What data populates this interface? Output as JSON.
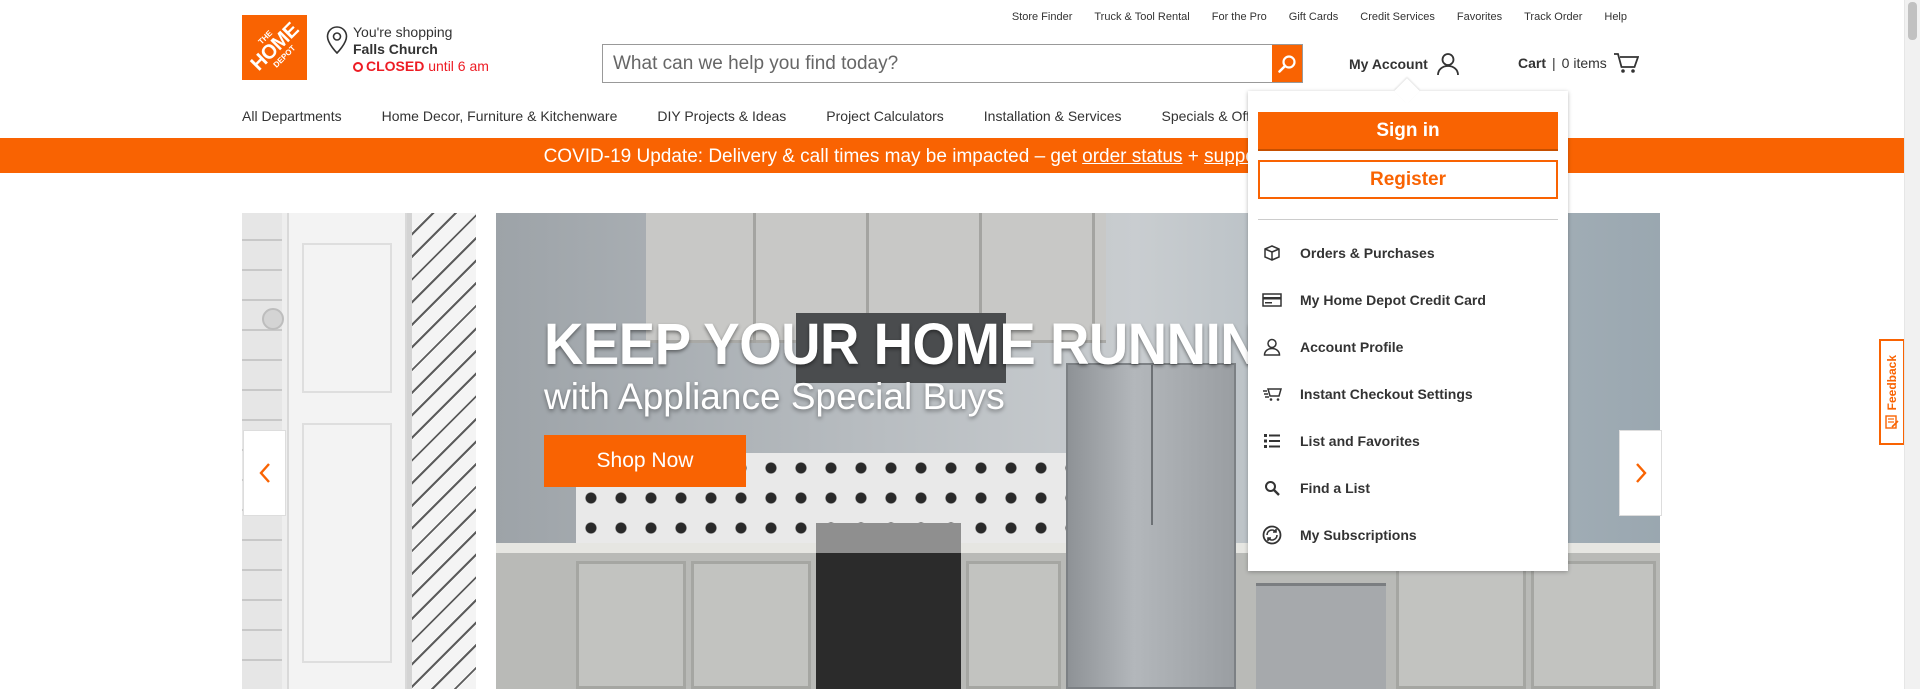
{
  "logo": {
    "line1": "THE",
    "line2": "HOME",
    "line3": "DEPOT"
  },
  "store": {
    "label": "You're shopping",
    "city": "Falls Church",
    "status": "CLOSED",
    "until": "until 6 am"
  },
  "utility_links": [
    "Store Finder",
    "Truck & Tool Rental",
    "For the Pro",
    "Gift Cards",
    "Credit Services",
    "Favorites",
    "Track Order",
    "Help"
  ],
  "search": {
    "placeholder": "What can we help you find today?"
  },
  "account": {
    "label": "My Account"
  },
  "cart": {
    "label": "Cart",
    "separator": "|",
    "count": "0 items"
  },
  "nav": [
    "All Departments",
    "Home Decor, Furniture & Kitchenware",
    "DIY Projects & Ideas",
    "Project Calculators",
    "Installation & Services",
    "Specials & Offers"
  ],
  "covid": {
    "prefix": "COVID-19 Update: Delivery & call times may be impacted – get ",
    "link1": "order status",
    "plus": " + ",
    "link2": "support & services"
  },
  "hero": {
    "title": "KEEP YOUR HOME RUNNING",
    "subtitle": "with Appliance Special Buys",
    "button": "Shop Now"
  },
  "dropdown": {
    "signin": "Sign in",
    "register": "Register",
    "items": [
      {
        "label": "Orders & Purchases",
        "icon": "box-icon"
      },
      {
        "label": "My Home Depot Credit Card",
        "icon": "credit-card-icon"
      },
      {
        "label": "Account Profile",
        "icon": "user-icon"
      },
      {
        "label": "Instant Checkout Settings",
        "icon": "fast-cart-icon"
      },
      {
        "label": "List and Favorites",
        "icon": "list-icon"
      },
      {
        "label": "Find a List",
        "icon": "search-icon"
      },
      {
        "label": "My Subscriptions",
        "icon": "subscription-icon"
      }
    ]
  },
  "feedback": {
    "label": "Feedback"
  },
  "colors": {
    "brand": "#f96302",
    "closed": "#ed1c24"
  }
}
